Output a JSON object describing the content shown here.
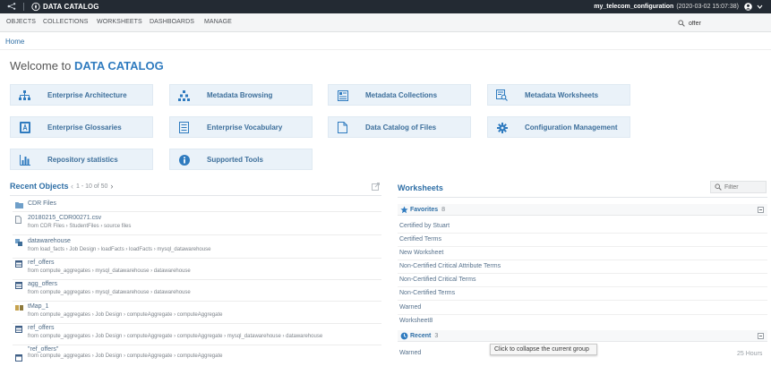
{
  "topbar": {
    "app_name": "DATA CATALOG",
    "config_name": "my_telecom_configuration",
    "datetime": "(2020-03-02 15:07:38)"
  },
  "nav": {
    "items": [
      "OBJECTS",
      "COLLECTIONS",
      "WORKSHEETS",
      "DASHBOARDS",
      "MANAGE"
    ],
    "search_value": "offer"
  },
  "breadcrumb": "Home",
  "welcome": {
    "prefix": "Welcome to",
    "brand": "DATA CATALOG"
  },
  "tiles": [
    {
      "label": "Enterprise Architecture",
      "icon": "hierarchy-icon"
    },
    {
      "label": "Metadata Browsing",
      "icon": "tree-icon"
    },
    {
      "label": "Metadata Collections",
      "icon": "collection-icon"
    },
    {
      "label": "Metadata Worksheets",
      "icon": "worksheet-search-icon"
    },
    {
      "label": "Enterprise Glossaries",
      "icon": "glossary-icon"
    },
    {
      "label": "Enterprise Vocabulary",
      "icon": "vocabulary-icon"
    },
    {
      "label": "Data Catalog of Files",
      "icon": "file-icon"
    },
    {
      "label": "Configuration Management",
      "icon": "gear-icon"
    },
    {
      "label": "Repository statistics",
      "icon": "bar-chart-icon"
    },
    {
      "label": "Supported Tools",
      "icon": "info-icon"
    }
  ],
  "recent": {
    "title": "Recent Objects",
    "pagination": "1 - 10 of 50",
    "items": [
      {
        "name": "CDR Files",
        "path": ""
      },
      {
        "name": "20180215_CDR00271.csv",
        "path": "from CDR Files › StudentFiles › source files"
      },
      {
        "name": "datawarehouse",
        "path": "from load_facts › Job Design › loadFacts › loadFacts › mysql_datawarehouse"
      },
      {
        "name": "ref_offers",
        "path": "from compute_aggregates › mysql_datawarehouse › datawarehouse"
      },
      {
        "name": "agg_offers",
        "path": "from compute_aggregates › mysql_datawarehouse › datawarehouse"
      },
      {
        "name": "tMap_1",
        "path": "from compute_aggregates › Job Design › computeAggregate › computeAggregate"
      },
      {
        "name": "ref_offers",
        "path": "from compute_aggregates › Job Design › computeAggregate › computeAggregate › mysql_datawarehouse › datawarehouse"
      },
      {
        "name": "\"ref_offers\"",
        "path": "from compute_aggregates › Job Design › computeAggregate › computeAggregate"
      }
    ]
  },
  "worksheets": {
    "title": "Worksheets",
    "filter_placeholder": "Filter",
    "favorites": {
      "label": "Favorites",
      "count": "8",
      "items": [
        "Certified by Stuart",
        "Certified Terms",
        "New Worksheet",
        "Non-Certified Critical Attribute Terms",
        "Non-Certified Critical Terms",
        "Non-Certified Terms",
        "Warned",
        "Worksheet8"
      ]
    },
    "recent": {
      "label": "Recent",
      "count": "3",
      "first_item": "Warned",
      "first_time": "25 Hours"
    }
  },
  "tooltip": "Click to collapse the current group",
  "colors": {
    "accent": "#2f7bbf",
    "topbar": "#232a33",
    "tile_bg": "#eaf2f9"
  }
}
